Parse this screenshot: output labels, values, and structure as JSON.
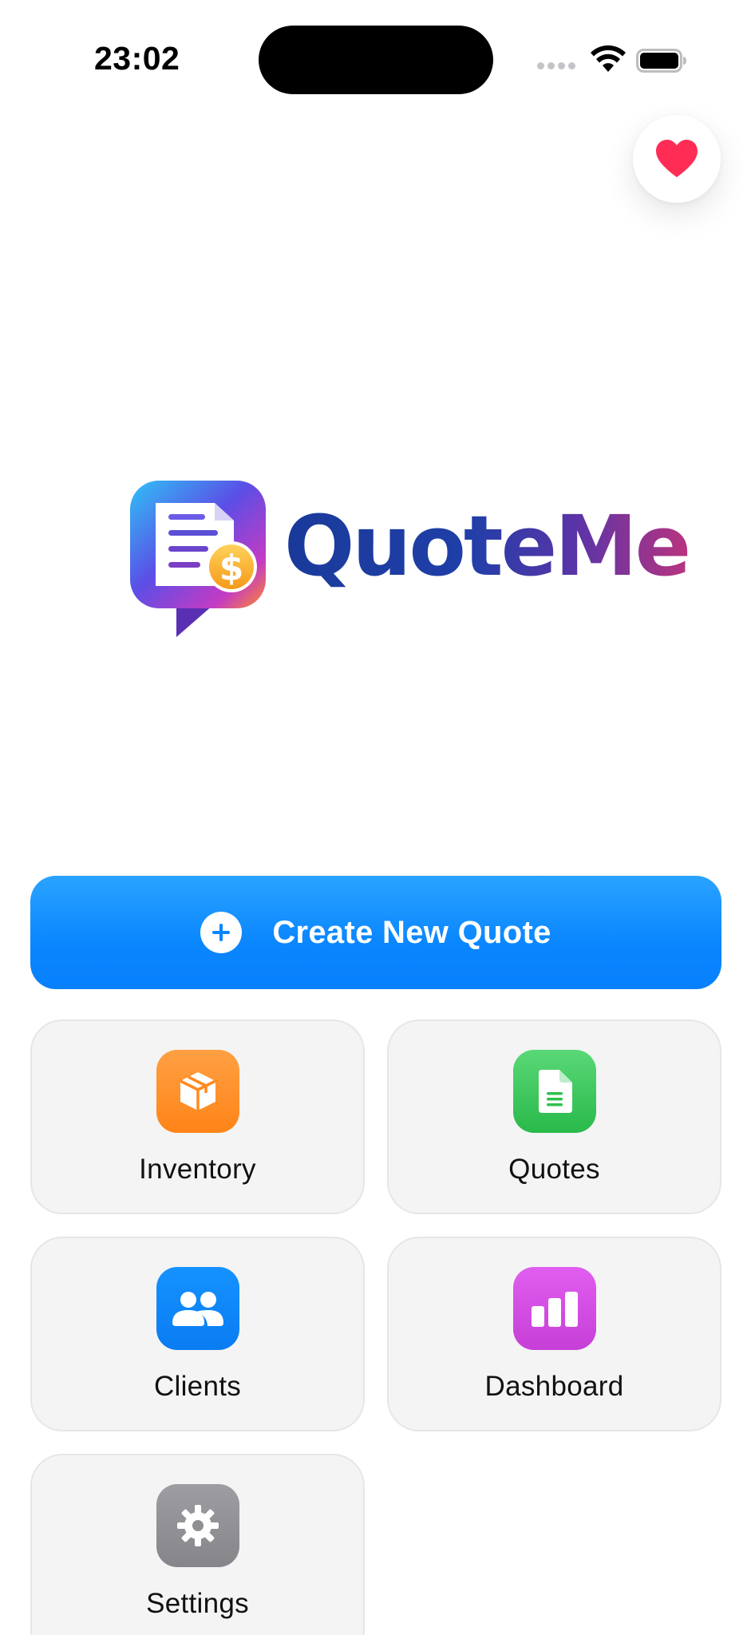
{
  "status_bar": {
    "time": "23:02"
  },
  "favorite": {
    "icon": "heart-icon",
    "color": "#ff2d55"
  },
  "brand": {
    "name": "QuoteMe",
    "icon": "quote-document-dollar-icon",
    "gradient": [
      "#1a3a9a",
      "#b9347f"
    ]
  },
  "primary_action": {
    "label": "Create New Quote",
    "icon": "plus-circle-icon",
    "color": "#0a86ff"
  },
  "tiles": [
    {
      "label": "Inventory",
      "icon": "box-icon",
      "color": "#ff8a1f"
    },
    {
      "label": "Quotes",
      "icon": "document-icon",
      "color": "#2fc14e"
    },
    {
      "label": "Clients",
      "icon": "people-icon",
      "color": "#0a84ff"
    },
    {
      "label": "Dashboard",
      "icon": "bar-chart-icon",
      "color": "#d44ee0"
    },
    {
      "label": "Settings",
      "icon": "gear-icon",
      "color": "#8e8e93"
    }
  ]
}
